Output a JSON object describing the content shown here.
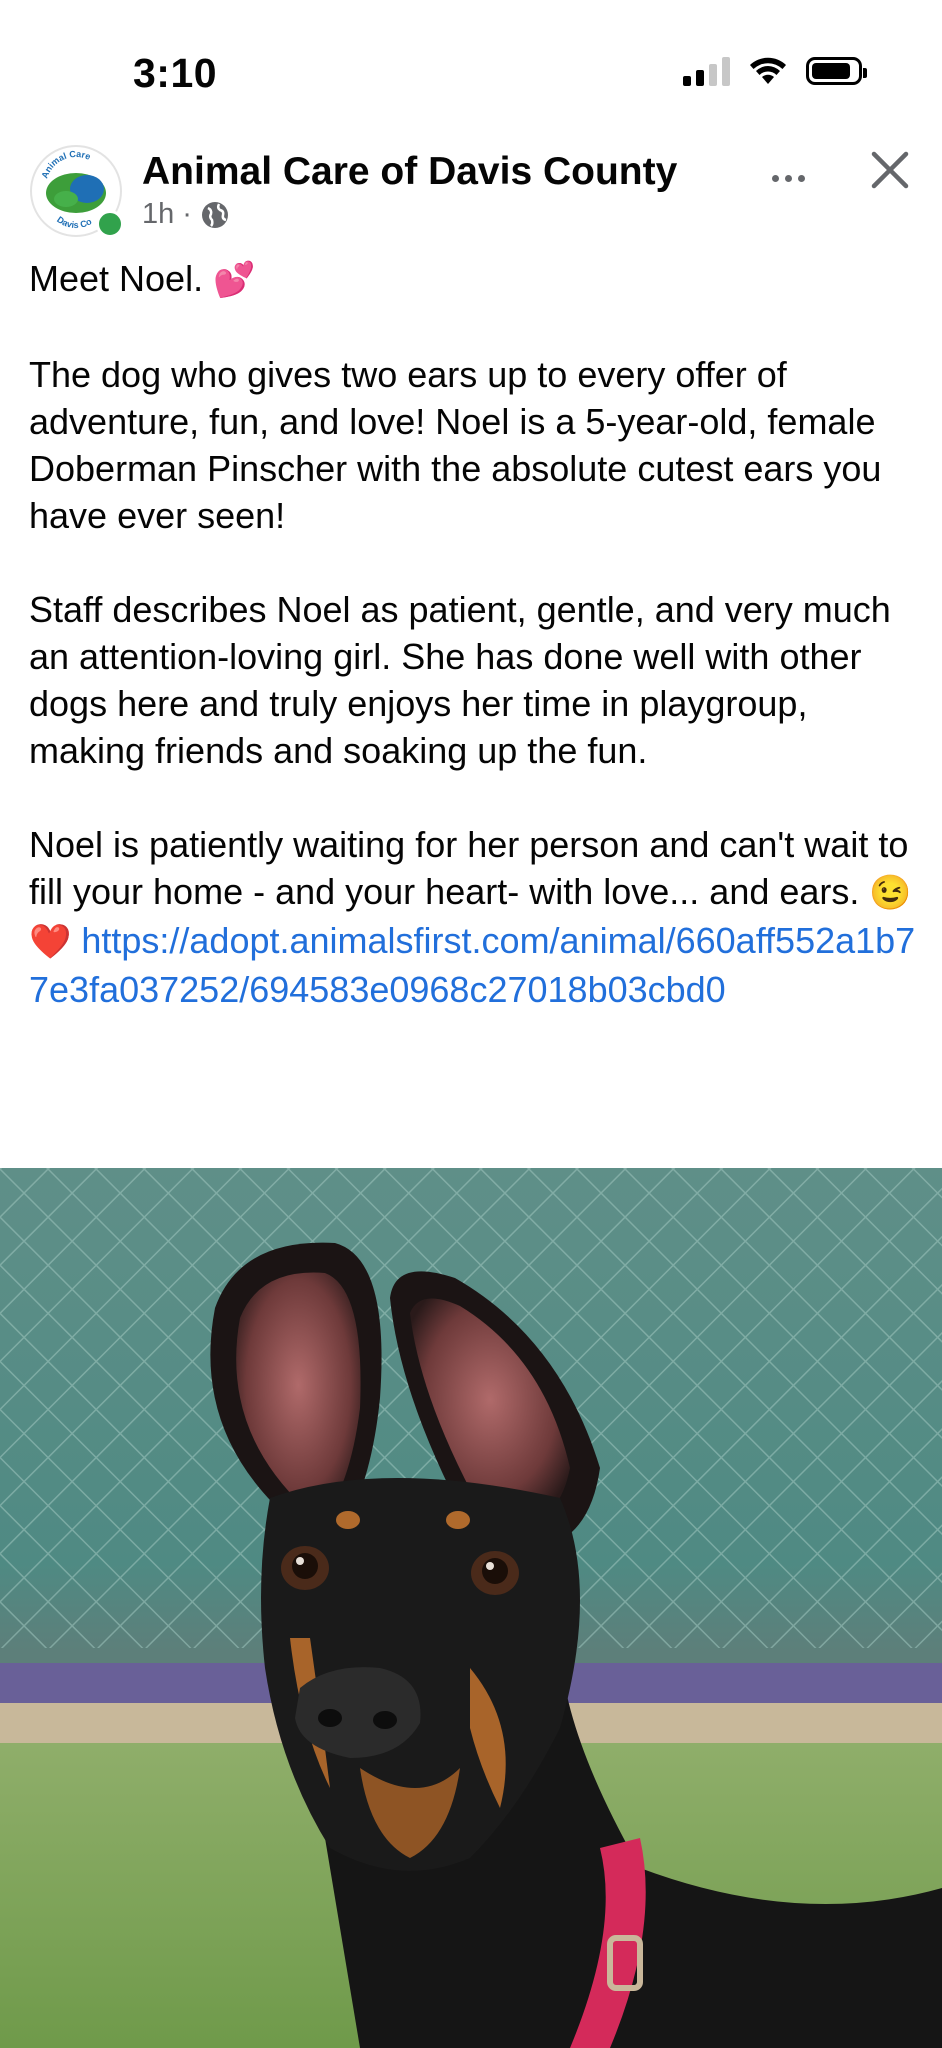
{
  "status_bar": {
    "time": "3:10"
  },
  "post": {
    "page_name": "Animal Care of Davis County",
    "time_ago": "1h",
    "separator": "·",
    "avatar_text_top": "Animal Care",
    "avatar_text_bottom": "Davis Co",
    "paragraphs": {
      "p1": "Meet Noel.",
      "p1_emoji": "💕",
      "p2": "The dog who gives two ears up to every offer of adventure, fun, and love! Noel is a 5-year-old, female Doberman Pinscher with the absolute cutest ears you have ever seen!",
      "p3": "Staff describes Noel as patient, gentle, and very much an attention-loving girl. She has done well with other dogs here and truly enjoys her time in playgroup, making friends and soaking up the fun.",
      "p4": "Noel is patiently waiting for her person and can't wait to fill your home - and your heart- with love... and ears.",
      "p4_emoji": "😉❤️",
      "link": "https://adopt.animalsfirst.com/animal/660aff552a1b77e3fa037252/694583e0968c27018b03cbd0"
    }
  },
  "icons": {
    "globe": "globe-icon",
    "more": "more-options-icon",
    "close": "close-icon",
    "signal": "cellular-signal-icon",
    "wifi": "wifi-icon",
    "battery": "battery-icon"
  },
  "colors": {
    "link": "#216fdb",
    "meta": "#65676b",
    "online": "#31a24c"
  }
}
